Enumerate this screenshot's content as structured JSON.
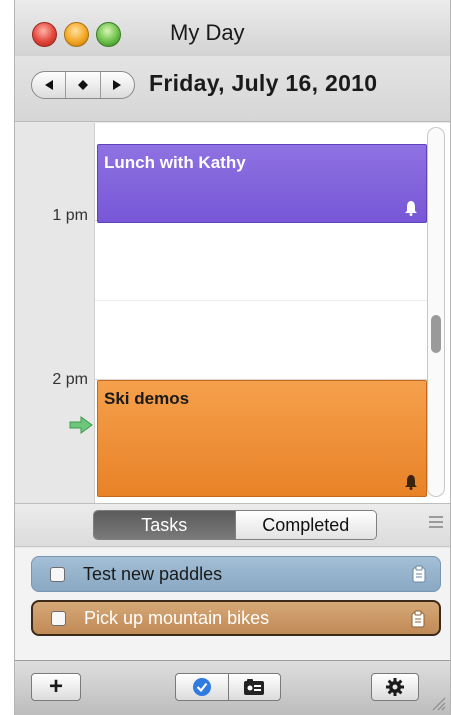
{
  "window": {
    "title": "My Day"
  },
  "date_nav": {
    "prev_icon": "triangle-left-icon",
    "today_icon": "diamond-icon",
    "next_icon": "triangle-right-icon",
    "date": "Friday, July 16, 2010"
  },
  "day_view": {
    "time_labels": [
      "1 pm",
      "2 pm"
    ],
    "events": [
      {
        "title": "Lunch with Kathy",
        "color": "#7b5bd8",
        "alarm_icon": "bell-icon"
      },
      {
        "title": "Ski demos",
        "color": "#ee8b30",
        "alarm_icon": "bell-icon"
      }
    ],
    "current_time_icon": "green-arrow-icon"
  },
  "task_tabs": {
    "active": "Tasks",
    "inactive": "Completed",
    "menu_icon": "list-lines-icon"
  },
  "tasks": [
    {
      "label": "Test new paddles",
      "checked": false,
      "color": "#97b3cc",
      "note_icon": "clipboard-icon"
    },
    {
      "label": "Pick up mountain bikes",
      "checked": false,
      "color": "#c99767",
      "note_icon": "clipboard-icon"
    }
  ],
  "toolbar": {
    "add_label": "+",
    "check_icon": "checkmark-icon",
    "contact_icon": "address-card-icon",
    "gear_icon": "gear-icon",
    "resize_icon": "resize-grip-icon"
  }
}
